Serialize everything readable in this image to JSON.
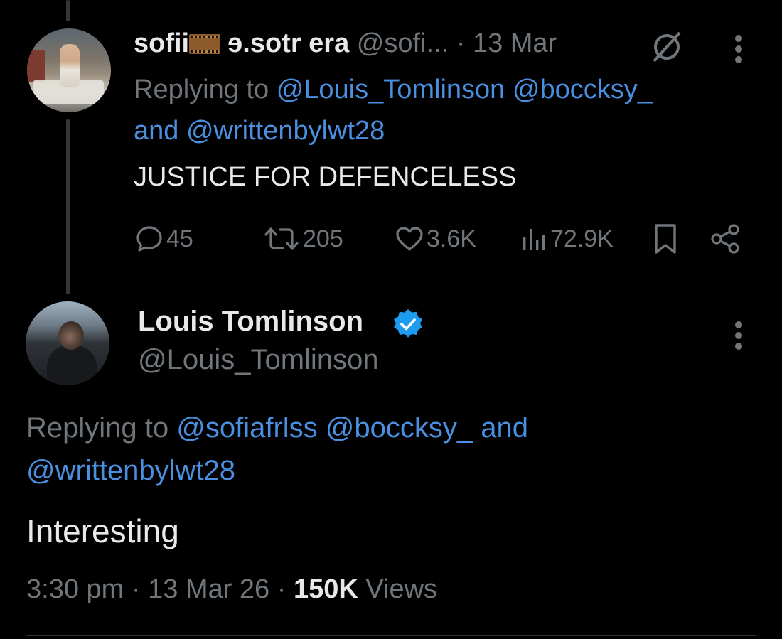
{
  "reply_tweet": {
    "display_name": "sofii",
    "display_name_suffix": "ɘ.sotr era",
    "emoji_icon": "film-frames-icon",
    "handle": "@sofi...",
    "date": "· 13 Mar",
    "replying_prefix": "Replying to",
    "mentions": [
      "@Louis_Tomlinson",
      "@boccksy_"
    ],
    "and_label": "and",
    "mention_last": "@writtenbylwt28",
    "text": "JUSTICE FOR DEFENCELESS",
    "stats": {
      "replies": "45",
      "retweets": "205",
      "likes": "3.6K",
      "views": "72.9K"
    }
  },
  "main_tweet": {
    "display_name": "Louis Tomlinson",
    "verified": true,
    "handle": "@Louis_Tomlinson",
    "replying_prefix": "Replying to",
    "mentions": [
      "@sofiafrlss",
      "@boccksy_"
    ],
    "and_label": "and",
    "mention_last": "@writtenbylwt28",
    "text": "Interesting",
    "time": "3:30 pm",
    "date": "13 Mar 26",
    "separator": "·",
    "views_count": "150K",
    "views_label": "Views"
  },
  "colors": {
    "background": "#000000",
    "text": "#e7e9ea",
    "muted": "#71767b",
    "link": "#4a8fe0",
    "verified": "#1d9bf0"
  }
}
